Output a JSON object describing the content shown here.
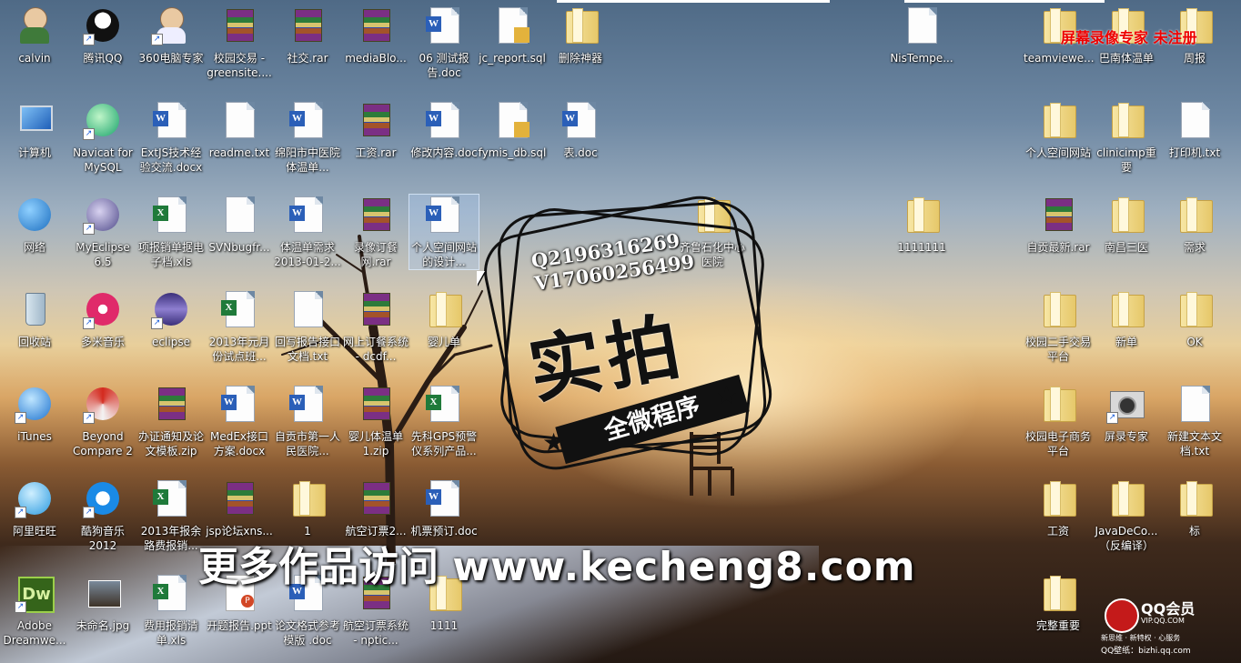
{
  "watermark_text": "更多作品访问",
  "watermark_url": "www.kecheng8.com",
  "recorder_notice": "屏幕录像专家  未注册",
  "stamp": {
    "qq": "Q2196316269",
    "v": "V17060256499",
    "main": "实拍",
    "ribbon": "全微程序"
  },
  "qqvip": {
    "title": "QQ会员",
    "domain": "VIP.QQ.COM",
    "slogan": "新思维 · 新特权 · 心服务",
    "wallpaper": "QQ壁纸：bizhi.qq.com"
  },
  "icons": [
    {
      "name": "calvin",
      "type": "person",
      "shortcut": false
    },
    {
      "name": "腾讯QQ",
      "type": "qq",
      "shortcut": true
    },
    {
      "name": "360电脑专家",
      "type": "doctor",
      "shortcut": true
    },
    {
      "name": "校园交易 - greensite....",
      "type": "rar",
      "shortcut": false
    },
    {
      "name": "社交.rar",
      "type": "rar",
      "shortcut": false
    },
    {
      "name": "mediaBlo...",
      "type": "rar",
      "shortcut": false
    },
    {
      "name": "06 测试报告.doc",
      "type": "word",
      "shortcut": false
    },
    {
      "name": "jc_report.sql",
      "type": "sql",
      "shortcut": false
    },
    {
      "name": "删除神器",
      "type": "folder",
      "shortcut": false
    },
    {
      "name": "NisTempe...",
      "type": "blank",
      "shortcut": false
    },
    {
      "name": "teamviewe...",
      "type": "folder",
      "shortcut": false
    },
    {
      "name": "巴南体温单",
      "type": "folder",
      "shortcut": false
    },
    {
      "name": "周报",
      "type": "folder",
      "shortcut": false
    },
    {
      "name": "计算机",
      "type": "computer",
      "shortcut": false
    },
    {
      "name": "Navicat for MySQL",
      "type": "navicat",
      "shortcut": true
    },
    {
      "name": "ExtJS技术经验交流.docx",
      "type": "word",
      "shortcut": false
    },
    {
      "name": "readme.txt",
      "type": "blank",
      "shortcut": false
    },
    {
      "name": "绵阳市中医院体温单...",
      "type": "word",
      "shortcut": false
    },
    {
      "name": "工资.rar",
      "type": "rar",
      "shortcut": false
    },
    {
      "name": "修改内容.doc",
      "type": "word",
      "shortcut": false
    },
    {
      "name": "fymis_db.sql",
      "type": "sql",
      "shortcut": false
    },
    {
      "name": "表.doc",
      "type": "word",
      "shortcut": false
    },
    {
      "name": "个人空间网站",
      "type": "folder",
      "shortcut": false
    },
    {
      "name": "clinicimp重要",
      "type": "folder",
      "shortcut": false
    },
    {
      "name": "打印机.txt",
      "type": "blank",
      "shortcut": false
    },
    {
      "name": "网络",
      "type": "network",
      "shortcut": false
    },
    {
      "name": "MyEclipse 6.5",
      "type": "myeclipse",
      "shortcut": true
    },
    {
      "name": "项报销单据电子档.xls",
      "type": "excel",
      "shortcut": false
    },
    {
      "name": "SVNbugfr...",
      "type": "blank",
      "shortcut": false
    },
    {
      "name": "体温单需求2013-01-2...",
      "type": "word",
      "shortcut": false
    },
    {
      "name": "录像订餐网.rar",
      "type": "rar",
      "shortcut": false
    },
    {
      "name": "个人空间网站的设计...",
      "type": "word",
      "shortcut": false,
      "selected": true
    },
    {
      "name": "齐鲁石化中心医院",
      "type": "folder",
      "shortcut": false
    },
    {
      "name": "1111111",
      "type": "folder",
      "shortcut": false
    },
    {
      "name": "自贡最新.rar",
      "type": "rar",
      "shortcut": false
    },
    {
      "name": "南昌三医",
      "type": "folder",
      "shortcut": false
    },
    {
      "name": "需求",
      "type": "folder",
      "shortcut": false
    },
    {
      "name": "回收站",
      "type": "bin",
      "shortcut": false
    },
    {
      "name": "多米音乐",
      "type": "duomi",
      "shortcut": true
    },
    {
      "name": "eclipse",
      "type": "eclipse",
      "shortcut": true
    },
    {
      "name": "2013年元月份试点班...",
      "type": "excel",
      "shortcut": false
    },
    {
      "name": "回写报告接口文档.txt",
      "type": "blank",
      "shortcut": false
    },
    {
      "name": "网上订餐系统 - dcdf...",
      "type": "rar",
      "shortcut": false
    },
    {
      "name": "婴儿单",
      "type": "folder",
      "shortcut": false
    },
    {
      "name": "校园二手交易平台",
      "type": "folder",
      "shortcut": false
    },
    {
      "name": "新单",
      "type": "folder",
      "shortcut": false
    },
    {
      "name": "OK",
      "type": "folder",
      "shortcut": false
    },
    {
      "name": "iTunes",
      "type": "itunes",
      "shortcut": true
    },
    {
      "name": "Beyond Compare 2",
      "type": "beyond",
      "shortcut": true
    },
    {
      "name": "办证通知及论文模板.zip",
      "type": "rar",
      "shortcut": false
    },
    {
      "name": "MedEx接口方案.docx",
      "type": "word",
      "shortcut": false
    },
    {
      "name": "自贡市第一人民医院...",
      "type": "word",
      "shortcut": false
    },
    {
      "name": "婴儿体温单1.zip",
      "type": "rar",
      "shortcut": false
    },
    {
      "name": "先科GPS预警仪系列产品...",
      "type": "excel",
      "shortcut": false
    },
    {
      "name": "校园电子商务平台",
      "type": "folder",
      "shortcut": false
    },
    {
      "name": "屏录专家",
      "type": "camera",
      "shortcut": true
    },
    {
      "name": "新建文本文档.txt",
      "type": "blank",
      "shortcut": false
    },
    {
      "name": "阿里旺旺",
      "type": "wangwang",
      "shortcut": true
    },
    {
      "name": "酷狗音乐2012",
      "type": "kugou",
      "shortcut": true
    },
    {
      "name": "2013年报余路费报销...",
      "type": "excel",
      "shortcut": false
    },
    {
      "name": "jsp论坛xns...",
      "type": "rar",
      "shortcut": false
    },
    {
      "name": "1",
      "type": "folder",
      "shortcut": false
    },
    {
      "name": "航空订票2...",
      "type": "rar",
      "shortcut": false
    },
    {
      "name": "机票预订.doc",
      "type": "word",
      "shortcut": false
    },
    {
      "name": "工资",
      "type": "folder",
      "shortcut": false
    },
    {
      "name": "JavaDeCo... （反编译）",
      "type": "folder",
      "shortcut": false
    },
    {
      "name": "标",
      "type": "folder",
      "shortcut": false
    },
    {
      "name": "Adobe Dreamwe...",
      "type": "dreamweaver",
      "shortcut": true
    },
    {
      "name": "未命名.jpg",
      "type": "photo",
      "shortcut": false
    },
    {
      "name": "费用报销清单.xls",
      "type": "excel",
      "shortcut": false
    },
    {
      "name": "开题报告.ppt",
      "type": "ppt",
      "shortcut": false
    },
    {
      "name": "论文格式参考模版 .doc",
      "type": "word",
      "shortcut": false
    },
    {
      "name": "航空订票系统 - nptic...",
      "type": "rar",
      "shortcut": false
    },
    {
      "name": "1111",
      "type": "folder",
      "shortcut": false
    },
    {
      "name": "完整重要",
      "type": "folder",
      "shortcut": false
    }
  ]
}
